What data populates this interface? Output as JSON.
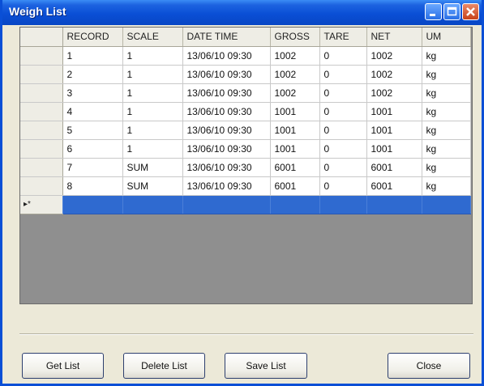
{
  "window": {
    "title": "Weigh List"
  },
  "columns": [
    "RECORD",
    "SCALE",
    "DATE TIME",
    "GROSS",
    "TARE",
    "NET",
    "UM"
  ],
  "rows": [
    [
      "1",
      "1",
      "13/06/10 09:30",
      "1002",
      "0",
      "1002",
      "kg"
    ],
    [
      "2",
      "1",
      "13/06/10 09:30",
      "1002",
      "0",
      "1002",
      "kg"
    ],
    [
      "3",
      "1",
      "13/06/10 09:30",
      "1002",
      "0",
      "1002",
      "kg"
    ],
    [
      "4",
      "1",
      "13/06/10 09:30",
      "1001",
      "0",
      "1001",
      "kg"
    ],
    [
      "5",
      "1",
      "13/06/10 09:30",
      "1001",
      "0",
      "1001",
      "kg"
    ],
    [
      "6",
      "1",
      "13/06/10 09:30",
      "1001",
      "0",
      "1001",
      "kg"
    ],
    [
      "7",
      "SUM",
      "13/06/10 09:30",
      "6001",
      "0",
      "6001",
      "kg"
    ],
    [
      "8",
      "SUM",
      "13/06/10 09:30",
      "6001",
      "0",
      "6001",
      "kg"
    ]
  ],
  "new_row_marker": "▸*",
  "buttons": {
    "get_list": "Get List",
    "delete_list": "Delete List",
    "save_list": "Save List",
    "close": "Close"
  },
  "icons": {
    "minimize": "minimize-icon",
    "maximize": "maximize-icon",
    "close": "close-icon"
  },
  "colors": {
    "titlebar": "#0a4fd6",
    "selected_row": "#2f6ad0",
    "grid_background": "#8f8f8f",
    "window_face": "#ece9d8"
  }
}
